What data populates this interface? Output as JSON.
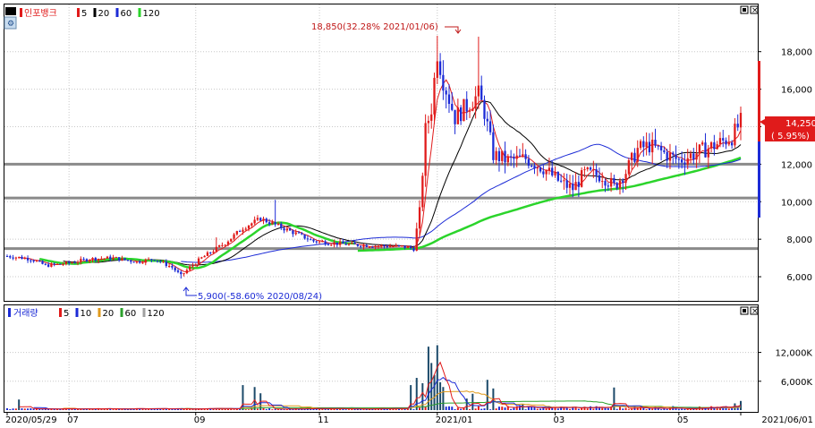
{
  "price_panel": {
    "legend": {
      "title": "인포뱅크",
      "items": [
        {
          "label": "5",
          "color": "#e01b1b"
        },
        {
          "label": "20",
          "color": "#000000"
        },
        {
          "label": "60",
          "color": "#1c2bd6"
        },
        {
          "label": "120",
          "color": "#2bd42b"
        }
      ]
    },
    "annotation_high": "18,850(32.28% 2021/01/06)",
    "annotation_low": "5,900(-58.60% 2020/08/24)",
    "current_price": "14,250",
    "current_change": "( 5.95%)"
  },
  "volume_panel": {
    "legend": {
      "title": "거래량",
      "items": [
        {
          "label": "5",
          "color": "#e01b1b"
        },
        {
          "label": "10",
          "color": "#1c2bd6"
        },
        {
          "label": "20",
          "color": "#e09a1b"
        },
        {
          "label": "60",
          "color": "#2ba02b"
        },
        {
          "label": "120",
          "color": "#a0a0a0"
        }
      ]
    }
  },
  "chart_data": {
    "type": "candlestick",
    "x_tick_labels": [
      {
        "label": "2020/05/29",
        "index": 0
      },
      {
        "label": "07",
        "index": 21
      },
      {
        "label": "09",
        "index": 64
      },
      {
        "label": "11",
        "index": 106
      },
      {
        "label": "2021/01",
        "index": 146
      },
      {
        "label": "03",
        "index": 186
      },
      {
        "label": "05",
        "index": 228
      },
      {
        "label": "2021/06/01",
        "index": 249
      }
    ],
    "y_price_ticks": [
      {
        "label": "6,000",
        "value": 6000
      },
      {
        "label": "8,000",
        "value": 8000
      },
      {
        "label": "10,000",
        "value": 10000
      },
      {
        "label": "12,000",
        "value": 12000
      },
      {
        "label": "14,000",
        "value": 14000
      },
      {
        "label": "16,000",
        "value": 16000
      },
      {
        "label": "18,000",
        "value": 18000
      }
    ],
    "y_volume_ticks": [
      {
        "label": "6,000K",
        "value": 6000
      },
      {
        "label": "12,000K",
        "value": 12000
      }
    ],
    "price_ylim": [
      5000,
      19800
    ],
    "volume_ylim": [
      0,
      19000
    ],
    "horizontal_levels": [
      12000,
      10200,
      7500
    ],
    "price_anchors": [
      [
        0,
        7100
      ],
      [
        8,
        6950
      ],
      [
        13,
        6600
      ],
      [
        20,
        6700
      ],
      [
        28,
        6950
      ],
      [
        36,
        7000
      ],
      [
        44,
        6800
      ],
      [
        50,
        6950
      ],
      [
        56,
        6500
      ],
      [
        59,
        6050
      ],
      [
        62,
        6500
      ],
      [
        66,
        7000
      ],
      [
        74,
        7800
      ],
      [
        80,
        8600
      ],
      [
        86,
        9100
      ],
      [
        92,
        8700
      ],
      [
        98,
        8300
      ],
      [
        104,
        7900
      ],
      [
        110,
        7800
      ],
      [
        118,
        7700
      ],
      [
        126,
        7650
      ],
      [
        134,
        7600
      ],
      [
        138,
        7500
      ],
      [
        140,
        9400
      ],
      [
        142,
        13800
      ],
      [
        144,
        15000
      ],
      [
        146,
        18000
      ],
      [
        148,
        16500
      ],
      [
        152,
        14500
      ],
      [
        156,
        15100
      ],
      [
        160,
        15700
      ],
      [
        162,
        14800
      ],
      [
        165,
        12500
      ],
      [
        170,
        12200
      ],
      [
        176,
        12300
      ],
      [
        182,
        11800
      ],
      [
        188,
        11000
      ],
      [
        192,
        10700
      ],
      [
        196,
        11500
      ],
      [
        202,
        11400
      ],
      [
        206,
        10800
      ],
      [
        210,
        11600
      ],
      [
        214,
        12800
      ],
      [
        218,
        13000
      ],
      [
        224,
        12500
      ],
      [
        228,
        12200
      ],
      [
        234,
        12600
      ],
      [
        240,
        13000
      ],
      [
        246,
        13450
      ],
      [
        249,
        14250
      ]
    ],
    "volume_spike_values": [
      {
        "index": 4,
        "value": 2200
      },
      {
        "index": 80,
        "value": 5200
      },
      {
        "index": 84,
        "value": 4800
      },
      {
        "index": 86,
        "value": 3500
      },
      {
        "index": 137,
        "value": 5200
      },
      {
        "index": 139,
        "value": 6700
      },
      {
        "index": 141,
        "value": 5600
      },
      {
        "index": 143,
        "value": 13200
      },
      {
        "index": 144,
        "value": 9800
      },
      {
        "index": 145,
        "value": 7300
      },
      {
        "index": 146,
        "value": 13500
      },
      {
        "index": 147,
        "value": 5800
      },
      {
        "index": 148,
        "value": 4800
      },
      {
        "index": 156,
        "value": 2400
      },
      {
        "index": 158,
        "value": 3400
      },
      {
        "index": 163,
        "value": 6300
      },
      {
        "index": 165,
        "value": 4500
      },
      {
        "index": 175,
        "value": 1300
      },
      {
        "index": 206,
        "value": 4700
      },
      {
        "index": 247,
        "value": 1400
      },
      {
        "index": 249,
        "value": 1900
      }
    ]
  }
}
